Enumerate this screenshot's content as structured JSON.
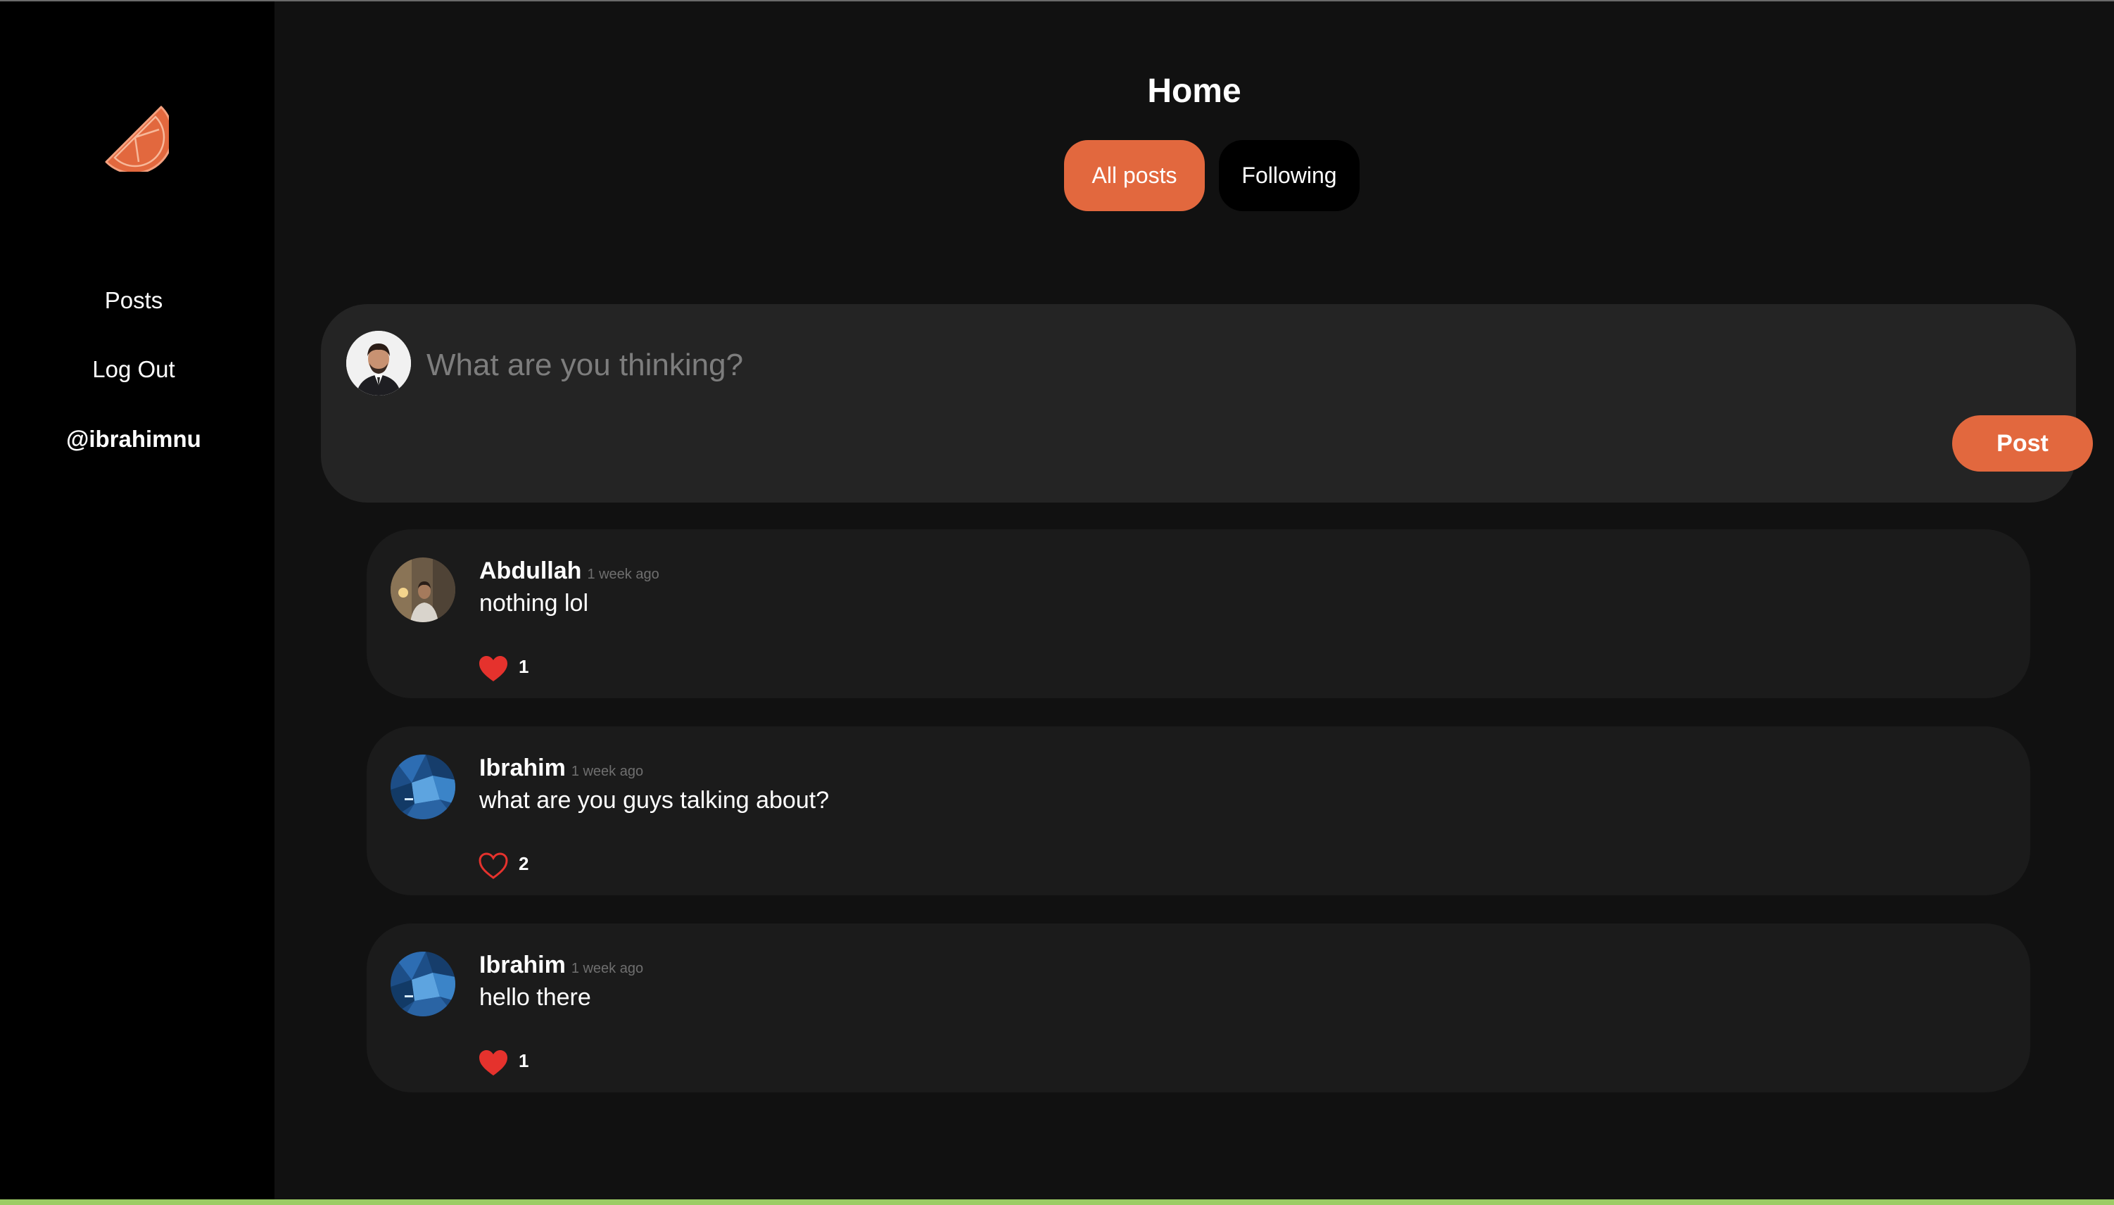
{
  "colors": {
    "accent": "#e2683e",
    "sidebar_bg": "#000000",
    "page_bg": "#111111",
    "card_bg": "#1b1b1b",
    "composer_bg": "#242424",
    "like_red": "#e5322d"
  },
  "sidebar": {
    "logo_icon": "orange-slice-icon",
    "items": [
      {
        "label": "Posts"
      },
      {
        "label": "Log Out"
      },
      {
        "label": "@ibrahimnu"
      }
    ]
  },
  "header": {
    "title": "Home",
    "tabs": [
      {
        "label": "All posts",
        "active": true
      },
      {
        "label": "Following",
        "active": false
      }
    ]
  },
  "composer": {
    "placeholder": "What are you thinking?",
    "value": "",
    "post_label": "Post"
  },
  "posts": [
    {
      "author": "Abdullah",
      "time": "1 week ago",
      "text": "nothing lol",
      "likes": "1",
      "liked": true,
      "avatar_icon": "user-photo-avatar"
    },
    {
      "author": "Ibrahim",
      "time": "1 week ago",
      "text": "what are you guys talking about?",
      "likes": "2",
      "liked": false,
      "avatar_icon": "blue-abstract-avatar"
    },
    {
      "author": "Ibrahim",
      "time": "1 week ago",
      "text": "hello there",
      "likes": "1",
      "liked": true,
      "avatar_icon": "blue-abstract-avatar"
    }
  ]
}
